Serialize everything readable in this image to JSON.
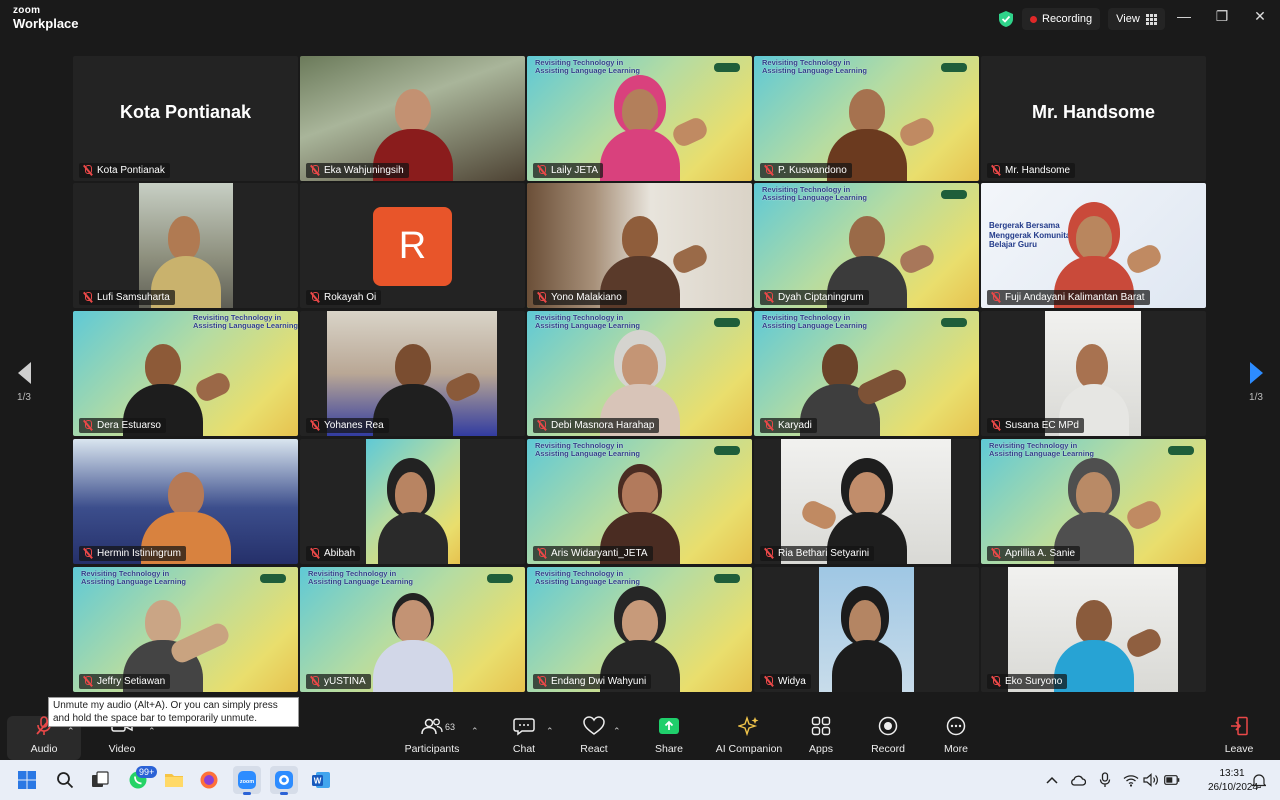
{
  "app": {
    "brand_top": "zoom",
    "brand_bottom": "Workplace"
  },
  "titlebar": {
    "recording_label": "Recording",
    "view_label": "View",
    "accent_color": "#2fd38a",
    "record_color": "#e02828"
  },
  "pager": {
    "left": "1/3",
    "right": "1/3"
  },
  "tiles": [
    {
      "name": "Kota Pontianak",
      "big_name": "Kota Pontianak"
    },
    {
      "name": "Eka Wahjuningsih"
    },
    {
      "name": "Laily JETA"
    },
    {
      "name": "P. Kuswandono"
    },
    {
      "name": "Mr. Handsome",
      "big_name": "Mr. Handsome"
    },
    {
      "name": "Lufi Samsuharta"
    },
    {
      "name": "Rokayah Oi",
      "avatar_letter": "R"
    },
    {
      "name": "Yono Malakiano"
    },
    {
      "name": "Dyah Ciptaningrum"
    },
    {
      "name": "Fuji Andayani Kalimantan Barat"
    },
    {
      "name": "Dera Estuarso"
    },
    {
      "name": "Yohanes Rea"
    },
    {
      "name": "Debi Masnora Harahap"
    },
    {
      "name": "Karyadi"
    },
    {
      "name": "Susana EC MPd"
    },
    {
      "name": "Hermin Istiningrum"
    },
    {
      "name": "Abibah"
    },
    {
      "name": "Aris Widaryanti_JETA"
    },
    {
      "name": "Ria Bethari Setyarini"
    },
    {
      "name": "Aprillia A. Sanie"
    },
    {
      "name": "Jeffry Setiawan"
    },
    {
      "name": "yUSTINA"
    },
    {
      "name": "Endang Dwi Wahyuni"
    },
    {
      "name": "Widya"
    },
    {
      "name": "Eko Suryono"
    }
  ],
  "slide": {
    "title": "Revisiting Technology in Assisting Language Learning",
    "banner_text": "Bergerak Bersama Menggerak Komunitas Belajar Guru"
  },
  "tooltip": "Unmute my audio (Alt+A). Or you can simply press and hold the space bar to temporarily unmute.",
  "toolbar": {
    "audio": "Audio",
    "video": "Video",
    "participants": "Participants",
    "participants_count": "63",
    "chat": "Chat",
    "react": "React",
    "share": "Share",
    "ai_companion": "AI Companion",
    "apps": "Apps",
    "record": "Record",
    "more": "More",
    "leave": "Leave",
    "share_color": "#1fcf6b"
  },
  "taskbar": {
    "badge": "99+",
    "time": "13:31",
    "date": "26/10/2024"
  }
}
